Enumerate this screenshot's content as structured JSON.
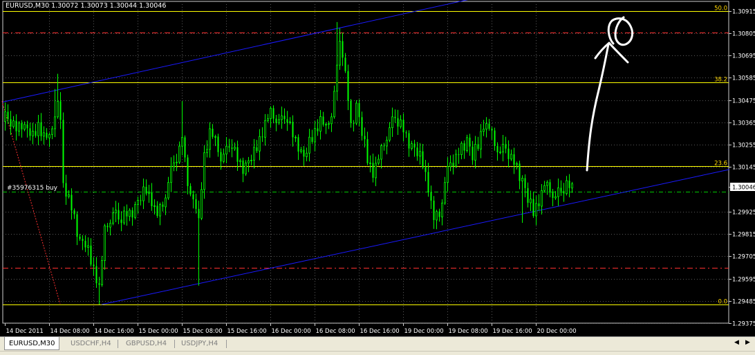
{
  "header": {
    "info": "EURUSD,M30  1.30072 1.30073 1.30044 1.30046"
  },
  "order_label": "#35976315 buy",
  "colors": {
    "background": "#000000",
    "grid": "#5a5a5a",
    "bull": "#00ff00",
    "bear": "#00ff00",
    "fib": "#ffff00",
    "fib_label": "#ffd700",
    "channel": "#1a1aff",
    "stop_level": "#ff3030",
    "order_line": "#00cc00",
    "annotation": "#ffffff",
    "current_price_box": "#ffffff",
    "axis_text": "#ffffff"
  },
  "chart_data": {
    "type": "candlestick",
    "symbol": "EURUSD",
    "timeframe": "M30",
    "ylim": [
      1.29375,
      1.30962
    ],
    "y_ticks": [
      "1.30915",
      "1.30805",
      "1.30695",
      "1.30585",
      "1.30475",
      "1.30365",
      "1.30255",
      "1.30145",
      "1.30046",
      "1.29925",
      "1.29815",
      "1.29705",
      "1.29595",
      "1.29485",
      "1.29375"
    ],
    "x_ticks": [
      "14 Dec 2011",
      "14 Dec 08:00",
      "14 Dec 16:00",
      "15 Dec 00:00",
      "15 Dec 08:00",
      "15 Dec 16:00",
      "16 Dec 00:00",
      "16 Dec 08:00",
      "16 Dec 16:00",
      "19 Dec 00:00",
      "19 Dec 08:00",
      "19 Dec 16:00",
      "20 Dec 00:00"
    ],
    "current_price": "1.30046",
    "fib_levels": [
      {
        "label": "50.0",
        "price": 1.30915
      },
      {
        "label": "38.2",
        "price": 1.30562
      },
      {
        "label": "23.6",
        "price": 1.3015
      },
      {
        "label": "0.0",
        "price": 1.29467
      }
    ],
    "red_levels": [
      1.30808,
      1.29649
    ],
    "order_line_price": 1.30025,
    "close_path": [
      [
        0,
        1.3037
      ],
      [
        2,
        1.3036
      ],
      [
        4,
        1.3033
      ],
      [
        6,
        1.3037
      ],
      [
        8,
        1.3032
      ],
      [
        10,
        1.3028
      ],
      [
        12,
        1.3035
      ],
      [
        14,
        1.303
      ],
      [
        16,
        1.3027
      ],
      [
        18,
        1.304
      ],
      [
        19,
        1.3045
      ],
      [
        20,
        1.3033
      ],
      [
        21,
        1.3005
      ],
      [
        23,
        1.2998
      ],
      [
        25,
        1.299
      ],
      [
        27,
        1.2978
      ],
      [
        29,
        1.2975
      ],
      [
        31,
        1.2968
      ],
      [
        33,
        1.296
      ],
      [
        34,
        1.2955
      ],
      [
        35,
        1.2968
      ],
      [
        36,
        1.2982
      ],
      [
        37,
        1.2985
      ],
      [
        39,
        1.299
      ],
      [
        41,
        1.2987
      ],
      [
        43,
        1.299
      ],
      [
        45,
        1.2992
      ],
      [
        47,
        1.2995
      ],
      [
        49,
        1.2998
      ],
      [
        51,
        1.3003
      ],
      [
        53,
        1.2998
      ],
      [
        55,
        1.299
      ],
      [
        57,
        1.2995
      ],
      [
        59,
        1.3005
      ],
      [
        61,
        1.3015
      ],
      [
        63,
        1.3022
      ],
      [
        64,
        1.303
      ],
      [
        65,
        1.3018
      ],
      [
        67,
        1.3
      ],
      [
        69,
        1.2994
      ],
      [
        70,
        1.2985
      ],
      [
        71,
        1.3005
      ],
      [
        72,
        1.302
      ],
      [
        74,
        1.3032
      ],
      [
        76,
        1.3026
      ],
      [
        78,
        1.3018
      ],
      [
        80,
        1.302
      ],
      [
        82,
        1.3025
      ],
      [
        84,
        1.3018
      ],
      [
        86,
        1.3015
      ],
      [
        88,
        1.3016
      ],
      [
        90,
        1.302
      ],
      [
        92,
        1.3028
      ],
      [
        94,
        1.3036
      ],
      [
        96,
        1.304
      ],
      [
        98,
        1.3037
      ],
      [
        100,
        1.3035
      ],
      [
        102,
        1.3038
      ],
      [
        104,
        1.303
      ],
      [
        106,
        1.3026
      ],
      [
        108,
        1.3018
      ],
      [
        110,
        1.3025
      ],
      [
        112,
        1.3032
      ],
      [
        114,
        1.3038
      ],
      [
        116,
        1.3032
      ],
      [
        118,
        1.304
      ],
      [
        120,
        1.306
      ],
      [
        121,
        1.3075
      ],
      [
        122,
        1.307
      ],
      [
        124,
        1.3048
      ],
      [
        125,
        1.3035
      ],
      [
        127,
        1.3045
      ],
      [
        129,
        1.303
      ],
      [
        131,
        1.3018
      ],
      [
        133,
        1.3012
      ],
      [
        135,
        1.3018
      ],
      [
        137,
        1.3025
      ],
      [
        139,
        1.3032
      ],
      [
        141,
        1.3037
      ],
      [
        143,
        1.3035
      ],
      [
        145,
        1.303
      ],
      [
        147,
        1.3025
      ],
      [
        149,
        1.302
      ],
      [
        151,
        1.3016
      ],
      [
        153,
        1.3005
      ],
      [
        155,
        1.2988
      ],
      [
        157,
        1.299
      ],
      [
        159,
        1.3005
      ],
      [
        161,
        1.3015
      ],
      [
        163,
        1.3018
      ],
      [
        165,
        1.3025
      ],
      [
        167,
        1.3028
      ],
      [
        169,
        1.3018
      ],
      [
        171,
        1.3025
      ],
      [
        173,
        1.3036
      ],
      [
        175,
        1.3033
      ],
      [
        177,
        1.3025
      ],
      [
        179,
        1.302
      ],
      [
        181,
        1.3022
      ],
      [
        183,
        1.3018
      ],
      [
        185,
        1.3015
      ],
      [
        187,
        1.3008
      ],
      [
        189,
        1.2997
      ],
      [
        191,
        1.2992
      ],
      [
        193,
        1.2998
      ],
      [
        195,
        1.3005
      ],
      [
        197,
        1.3002
      ],
      [
        199,
        1.2998
      ],
      [
        201,
        1.3001
      ],
      [
        203,
        1.3005
      ],
      [
        205,
        1.3005
      ]
    ],
    "candle_noise": [
      0.9,
      0.2,
      -0.6,
      0.7,
      -0.3,
      0.4,
      -0.8,
      0.5,
      0.1,
      -0.4,
      0.8,
      -0.2,
      0.6,
      -0.7,
      0.3,
      -0.1,
      0.7,
      -0.5,
      0.2,
      0.9
    ]
  },
  "tabs": [
    {
      "label": "EURUSD,M30"
    },
    {
      "label": "USDCHF,H4"
    },
    {
      "label": "GBPUSD,H4"
    },
    {
      "label": "USDJPY,H4"
    }
  ]
}
